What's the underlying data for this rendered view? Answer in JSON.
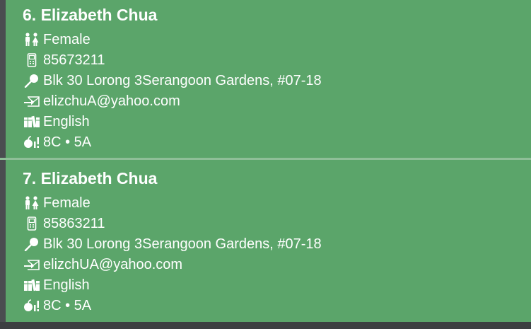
{
  "persons": [
    {
      "title": "6. Elizabeth Chua",
      "gender": "Female",
      "phone": "85673211",
      "address": "Blk 30 Lorong 3Serangoon Gardens, #07-18",
      "email": "elizchuA@yahoo.com",
      "language": "English",
      "grades": "8C • 5A"
    },
    {
      "title": "7. Elizabeth Chua",
      "gender": "Female",
      "phone": "85863211",
      "address": "Blk 30 Lorong 3Serangoon Gardens, #07-18",
      "email": "elizchUA@yahoo.com",
      "language": "English",
      "grades": "8C • 5A"
    }
  ],
  "icons": {
    "gender": "gender-icon",
    "phone": "phone-icon",
    "address": "map-pin-icon",
    "email": "email-icon",
    "language": "books-icon",
    "grades": "grades-icon"
  },
  "colors": {
    "card_background": "#5ba56a",
    "window_background": "#3c3f41",
    "text": "#ffffff"
  }
}
